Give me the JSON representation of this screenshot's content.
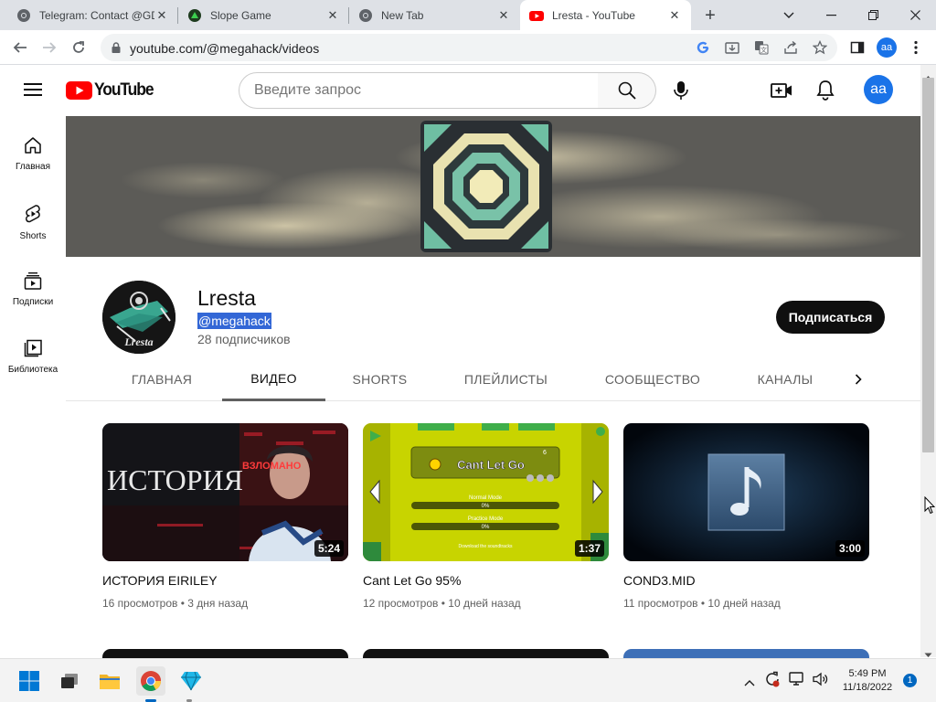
{
  "browser": {
    "tabs": [
      {
        "title": "Telegram: Contact @GD"
      },
      {
        "title": "Slope Game"
      },
      {
        "title": "New Tab"
      },
      {
        "title": "Lresta - YouTube"
      }
    ],
    "url": "youtube.com/@megahack/videos"
  },
  "youtube": {
    "logo_text": "YouTube",
    "search_placeholder": "Введите запрос",
    "account_initials": "aa",
    "guide": [
      {
        "label": "Главная",
        "icon": "home-icon"
      },
      {
        "label": "Shorts",
        "icon": "shorts-icon"
      },
      {
        "label": "Подписки",
        "icon": "subscriptions-icon"
      },
      {
        "label": "Библиотека",
        "icon": "library-icon"
      }
    ],
    "channel": {
      "name": "Lresta",
      "handle": "@megahack",
      "subscribers": "28 подписчиков",
      "avatar_text": "Lresta",
      "subscribe_label": "Подписаться",
      "tabs": [
        "ГЛАВНАЯ",
        "ВИДЕО",
        "SHORTS",
        "ПЛЕЙЛИСТЫ",
        "СООБЩЕСТВО",
        "КАНАЛЫ"
      ],
      "selected_tab": "ВИДЕО"
    },
    "videos": [
      {
        "title": "ИСТОРИЯ EIRILEY",
        "duration": "5:24",
        "views": "16 просмотров",
        "age": "3 дня назад",
        "thumb_text": "ИСТОРИЯ",
        "thumb_stamp": "ВЗЛОМАНО"
      },
      {
        "title": "Cant Let Go 95%",
        "duration": "1:37",
        "views": "12 просмотров",
        "age": "10 дней назад",
        "thumb_text": "Cant Let Go",
        "thumb_normal": "Normal Mode",
        "thumb_normal_pct": "0%",
        "thumb_practice": "Practice Mode",
        "thumb_practice_pct": "0%",
        "thumb_footer": "Download the soundtracks",
        "thumb_stars": "6"
      },
      {
        "title": "COND3.MID",
        "duration": "3:00",
        "views": "11 просмотров",
        "age": "10 дней назад"
      }
    ]
  },
  "taskbar": {
    "time": "5:49 PM",
    "date": "11/18/2022",
    "notifications": "1"
  },
  "colors": {
    "yt_red": "#ff0000",
    "subscribe_bg": "#0f0f0f",
    "avatar_blue": "#1a73e8",
    "selection_blue": "#3367d6"
  }
}
